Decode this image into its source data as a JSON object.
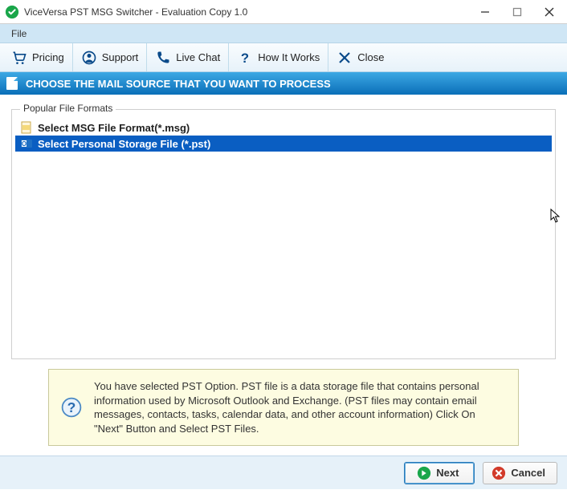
{
  "window": {
    "title": "ViceVersa PST MSG Switcher - Evaluation Copy 1.0"
  },
  "menubar": {
    "file": "File"
  },
  "toolbar": {
    "pricing": "Pricing",
    "support": "Support",
    "livechat": "Live Chat",
    "howitworks": "How It Works",
    "close": "Close"
  },
  "section": {
    "heading": "CHOOSE THE MAIL SOURCE THAT YOU WANT TO PROCESS"
  },
  "group": {
    "label": "Popular File Formats"
  },
  "formats": {
    "msg": "Select MSG File Format(*.msg)",
    "pst": "Select Personal Storage File (*.pst)"
  },
  "info": {
    "text": "You have selected PST Option. PST file is a data storage file that contains personal information used by Microsoft Outlook and Exchange. (PST files may contain email messages, contacts, tasks, calendar data, and other account information) Click On \"Next\" Button and Select PST Files."
  },
  "footer": {
    "next": "Next",
    "cancel": "Cancel"
  }
}
